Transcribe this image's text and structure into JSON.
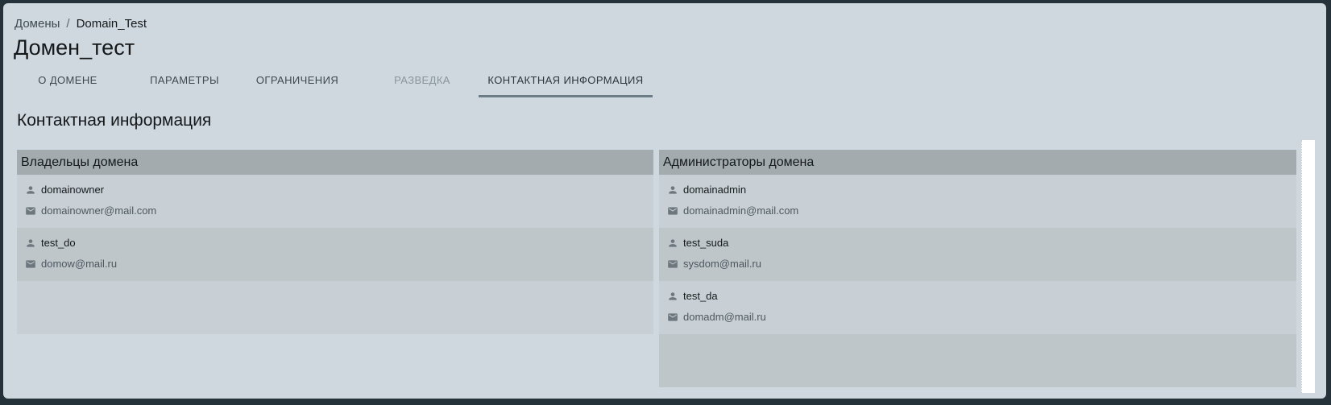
{
  "breadcrumb": {
    "root": "Домены",
    "separator": "/",
    "current": "Domain_Test"
  },
  "page_title": "Домен_тест",
  "tabs": [
    {
      "label": "О ДОМЕНЕ"
    },
    {
      "label": "ПАРАМЕТРЫ"
    },
    {
      "label": "ОГРАНИЧЕНИЯ"
    },
    {
      "label": "РАЗВЕДКА"
    },
    {
      "label": "КОНТАКТНАЯ ИНФОРМАЦИЯ"
    }
  ],
  "section_title": "Контактная информация",
  "owners": {
    "title": "Владельцы домена",
    "items": [
      {
        "name": "domainowner",
        "email": "domainowner@mail.com"
      },
      {
        "name": "test_do",
        "email": "domow@mail.ru"
      }
    ]
  },
  "admins": {
    "title": "Администраторы домена",
    "items": [
      {
        "name": "domainadmin",
        "email": "domainadmin@mail.com"
      },
      {
        "name": "test_suda",
        "email": "sysdom@mail.ru"
      },
      {
        "name": "test_da",
        "email": "domadm@mail.ru"
      }
    ]
  },
  "icons": {
    "user": "person-icon",
    "email": "mail-icon"
  },
  "colors": {
    "background": "#cfd8de",
    "header": "#a3abae",
    "active_tab_underline": "#6d7b84"
  }
}
